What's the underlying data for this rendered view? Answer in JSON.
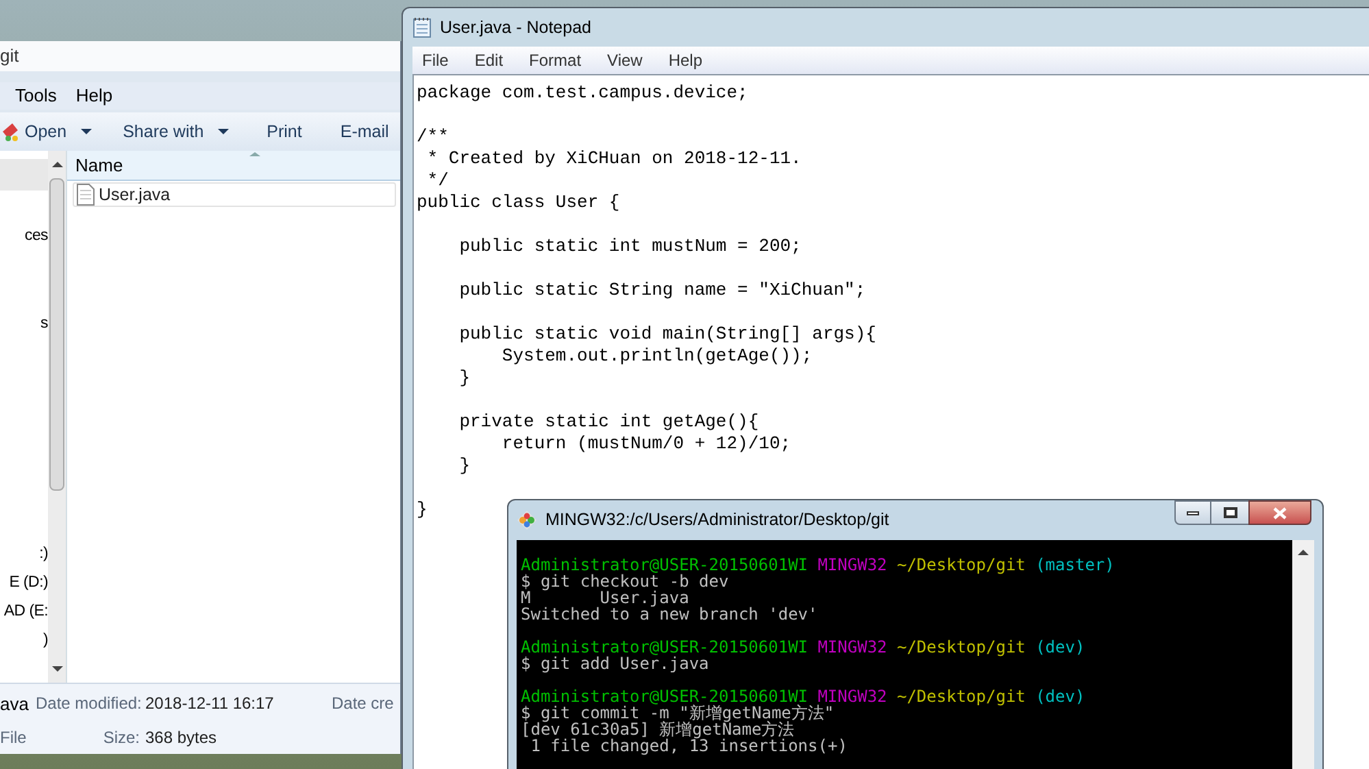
{
  "explorer": {
    "title": "git",
    "menu": [
      "Tools",
      "Help"
    ],
    "toolbar": [
      {
        "label": "Open",
        "kind": "dropdown"
      },
      {
        "label": "Share with",
        "kind": "dropdown"
      },
      {
        "label": "Print",
        "kind": "plain"
      },
      {
        "label": "E-mail",
        "kind": "plain"
      }
    ],
    "nav_items": [
      {
        "label": "ces",
        "selected": false
      },
      {
        "label": "s",
        "selected": false
      },
      {
        "label": ":)",
        "selected": false
      },
      {
        "label": "E (D:)",
        "selected": false
      },
      {
        "label": "AD (E:",
        "selected": false
      },
      {
        "label": ")",
        "selected": false
      }
    ],
    "column": "Name",
    "files": [
      {
        "name": "User.java",
        "selected": false
      }
    ],
    "details": {
      "name": "ava",
      "type": "File",
      "fields": [
        {
          "label": "Date modified:",
          "value": "2018-12-11 16:17"
        },
        {
          "label": "Size:",
          "value": "368 bytes"
        }
      ],
      "cut_label": "Date cre"
    }
  },
  "notepad": {
    "title": "User.java - Notepad",
    "menu": [
      "File",
      "Edit",
      "Format",
      "View",
      "Help"
    ],
    "blocks": [
      {
        "lines": [
          "package com.test.campus.device;"
        ]
      },
      {
        "lines": [
          "/**",
          " * Created by XiCHuan on 2018-12-11.",
          " */",
          "public class User {"
        ]
      },
      {
        "lines": [
          "    public static int mustNum = 200;"
        ]
      },
      {
        "lines": [
          "    public static String name = \"XiChuan\";"
        ]
      },
      {
        "lines": [
          "    public static void main(String[] args){",
          "        System.out.println(getAge());",
          "    }"
        ]
      },
      {
        "lines": [
          "    private static int getAge(){",
          "        return (mustNum/0 + 12)/10;",
          "    }"
        ]
      },
      {
        "lines": [
          "}"
        ]
      }
    ]
  },
  "terminal": {
    "title": "MINGW32:/c/Users/Administrator/Desktop/git",
    "blocks": [
      {
        "lines": [
          {
            "segments": [
              {
                "text": "Administrator@USER-20150601WI",
                "color": "#00c000"
              },
              {
                "text": "MINGW32",
                "color": "#c000c0"
              },
              {
                "text": "~/Desktop/git",
                "color": "#c0c000"
              },
              {
                "text": "(master)",
                "color": "#00c0c0"
              }
            ]
          },
          {
            "segments": [
              {
                "text": "$ git checkout -b dev",
                "color": "#c0c0c0"
              }
            ]
          },
          {
            "segments": [
              {
                "text": "M       User.java",
                "color": "#c0c0c0"
              }
            ]
          },
          {
            "segments": [
              {
                "text": "Switched to a new branch 'dev'",
                "color": "#c0c0c0"
              }
            ]
          }
        ]
      },
      {
        "lines": [
          {
            "segments": [
              {
                "text": "Administrator@USER-20150601WI",
                "color": "#00c000"
              },
              {
                "text": "MINGW32",
                "color": "#c000c0"
              },
              {
                "text": "~/Desktop/git",
                "color": "#c0c000"
              },
              {
                "text": "(dev)",
                "color": "#00c0c0"
              }
            ]
          },
          {
            "segments": [
              {
                "text": "$ git add User.java",
                "color": "#c0c0c0"
              }
            ]
          }
        ]
      },
      {
        "lines": [
          {
            "segments": [
              {
                "text": "Administrator@USER-20150601WI",
                "color": "#00c000"
              },
              {
                "text": "MINGW32",
                "color": "#c000c0"
              },
              {
                "text": "~/Desktop/git",
                "color": "#c0c000"
              },
              {
                "text": "(dev)",
                "color": "#00c0c0"
              }
            ]
          },
          {
            "segments": [
              {
                "text": "$ git commit -m \"新增getName方法\"",
                "color": "#c0c0c0"
              }
            ]
          },
          {
            "segments": [
              {
                "text": "[dev 61c30a5] 新增getName方法",
                "color": "#c0c0c0"
              }
            ]
          },
          {
            "segments": [
              {
                "text": " 1 file changed, 13 insertions(+)",
                "color": "#c0c0c0"
              }
            ]
          }
        ]
      }
    ]
  }
}
